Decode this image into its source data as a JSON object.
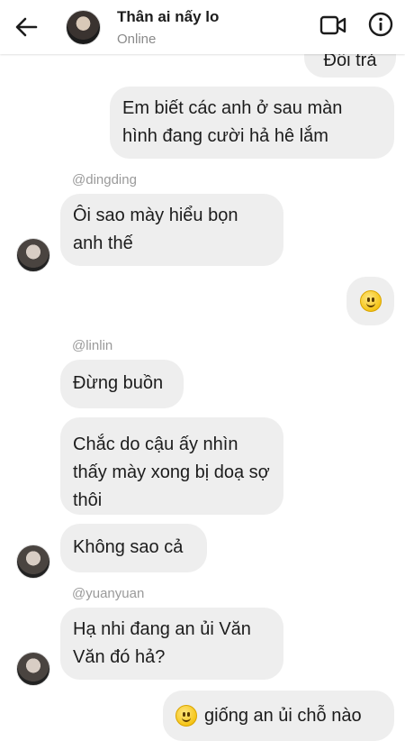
{
  "header": {
    "title": "Thân ai nấy lo",
    "status": "Online"
  },
  "messages": {
    "m0": "Đối trả",
    "m1": "Em biết các anh ở sau màn hình đang cười hả hê lắm",
    "s1": "@dingding",
    "m2": "Ôi sao mày hiểu bọn anh thế",
    "s2": "@linlin",
    "m4": "Đừng buồn",
    "m5": "Chắc do cậu ấy nhìn thấy mày xong bị doạ sợ thôi",
    "m6": "Không sao cả",
    "s3": "@yuanyuan",
    "m7": "Hạ nhi đang an ủi Văn Văn đó hả?",
    "m8": "giống an ủi chỗ nào"
  },
  "icons": {
    "back": "arrow-left-icon",
    "video": "video-camera-icon",
    "info": "info-icon",
    "emoji": "slightly-smiling-face"
  }
}
